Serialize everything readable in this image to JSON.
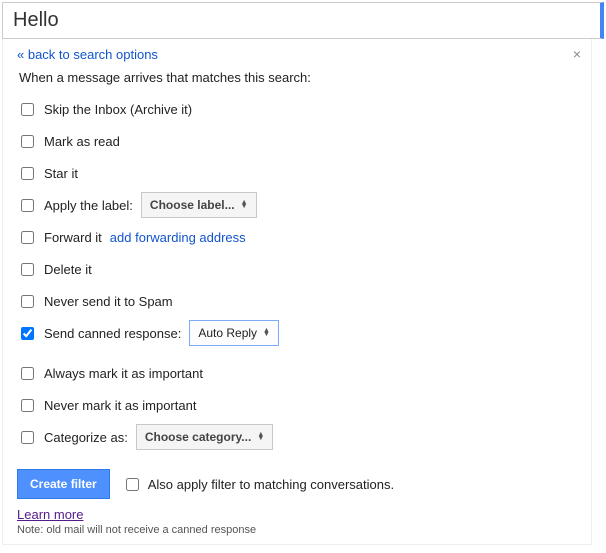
{
  "search": {
    "value": "Hello"
  },
  "back_link": "« back to search options",
  "intro": "When a message arrives that matches this search:",
  "options": {
    "skip_inbox": "Skip the Inbox (Archive it)",
    "mark_read": "Mark as read",
    "star": "Star it",
    "apply_label": "Apply the label:",
    "apply_label_dropdown": "Choose label...",
    "forward": "Forward it",
    "forward_link": "add forwarding address",
    "delete": "Delete it",
    "never_spam": "Never send it to Spam",
    "canned": "Send canned response:",
    "canned_dropdown": "Auto Reply",
    "always_important": "Always mark it as important",
    "never_important": "Never mark it as important",
    "categorize": "Categorize as:",
    "categorize_dropdown": "Choose category..."
  },
  "footer": {
    "create": "Create filter",
    "also_apply": "Also apply filter to matching conversations.",
    "learn_more": "Learn more",
    "note": "Note: old mail will not receive a canned response"
  }
}
